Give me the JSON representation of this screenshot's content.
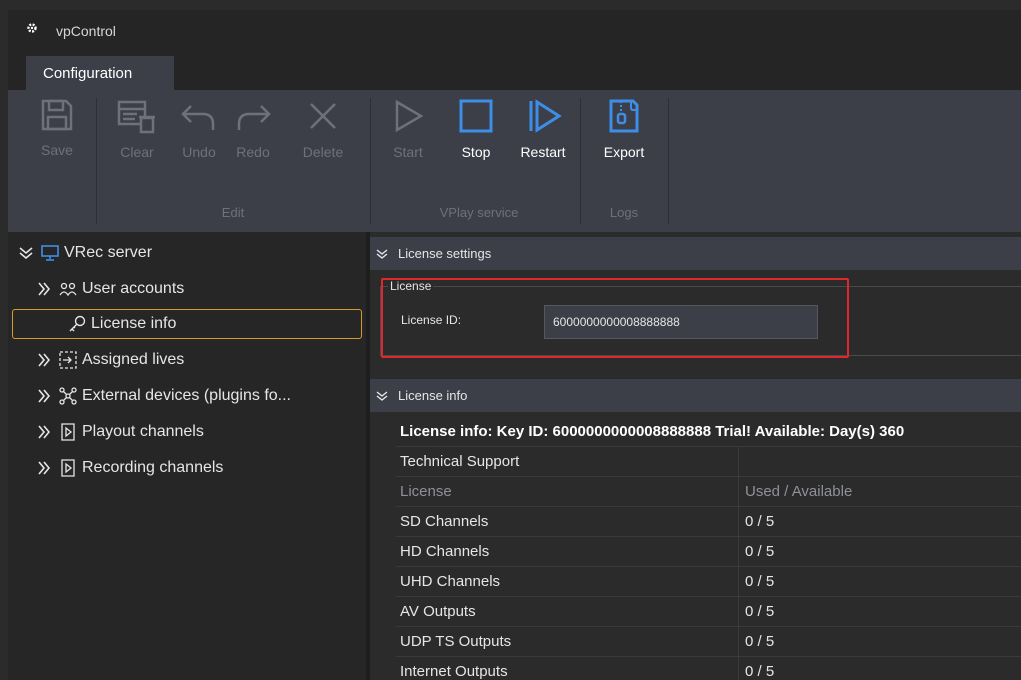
{
  "app": {
    "title": "vpControl"
  },
  "tabs": [
    {
      "label": "Configuration"
    }
  ],
  "ribbon": {
    "buttons": {
      "save": "Save",
      "clear": "Clear",
      "undo": "Undo",
      "redo": "Redo",
      "delete": "Delete",
      "start": "Start",
      "stop": "Stop",
      "restart": "Restart",
      "export": "Export"
    },
    "groups": {
      "edit": "Edit",
      "vplay": "VPlay service",
      "logs": "Logs"
    }
  },
  "tree": {
    "root": "VRec server",
    "items": [
      {
        "label": "User accounts",
        "icon": "users-icon"
      },
      {
        "label": "License info",
        "icon": "key-icon"
      },
      {
        "label": "Assigned lives",
        "icon": "assign-icon"
      },
      {
        "label": "External devices (plugins fo...",
        "icon": "network-icon"
      },
      {
        "label": "Playout channels",
        "icon": "channel-icon"
      },
      {
        "label": "Recording channels",
        "icon": "channel-icon"
      }
    ]
  },
  "license_settings": {
    "header": "License settings",
    "group_title": "License",
    "id_label": "License ID:",
    "id_value": "6000000000008888888"
  },
  "license_info": {
    "header": "License info",
    "summary": "License info: Key ID: 6000000000008888888 Trial! Available: Day(s) 360",
    "support_label": "Technical Support",
    "col_license": "License",
    "col_used": "Used / Available",
    "rows": [
      {
        "name": "SD Channels",
        "value": "0 / 5"
      },
      {
        "name": "HD Channels",
        "value": "0 / 5"
      },
      {
        "name": "UHD Channels",
        "value": "0 / 5"
      },
      {
        "name": "AV Outputs",
        "value": "0 / 5"
      },
      {
        "name": "UDP TS Outputs",
        "value": "0 / 5"
      },
      {
        "name": "Internet Outputs",
        "value": "0 / 5"
      }
    ]
  },
  "colors": {
    "selection_border": "#d79a2c",
    "highlight_box": "#e0262e",
    "panel": "#3c3f48"
  }
}
